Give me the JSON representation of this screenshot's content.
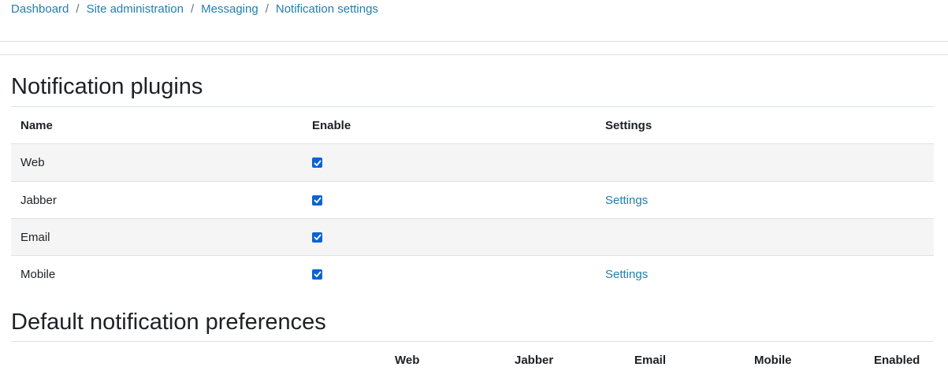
{
  "breadcrumb": {
    "items": [
      "Dashboard",
      "Site administration",
      "Messaging",
      "Notification settings"
    ],
    "separator": "/"
  },
  "plugins": {
    "title": "Notification plugins",
    "columns": [
      "Name",
      "Enable",
      "Settings"
    ],
    "rows": [
      {
        "name": "Web",
        "enabled": true,
        "settings": ""
      },
      {
        "name": "Jabber",
        "enabled": true,
        "settings": "Settings"
      },
      {
        "name": "Email",
        "enabled": true,
        "settings": ""
      },
      {
        "name": "Mobile",
        "enabled": true,
        "settings": "Settings"
      }
    ]
  },
  "preferences": {
    "title": "Default notification preferences",
    "columns": [
      "Web",
      "Jabber",
      "Email",
      "Mobile",
      "Enabled"
    ]
  },
  "colors": {
    "link": "#1f7fb0",
    "checkbox": "#0b63d6",
    "stripe": "#f5f5f5",
    "border": "#dee2e6"
  }
}
